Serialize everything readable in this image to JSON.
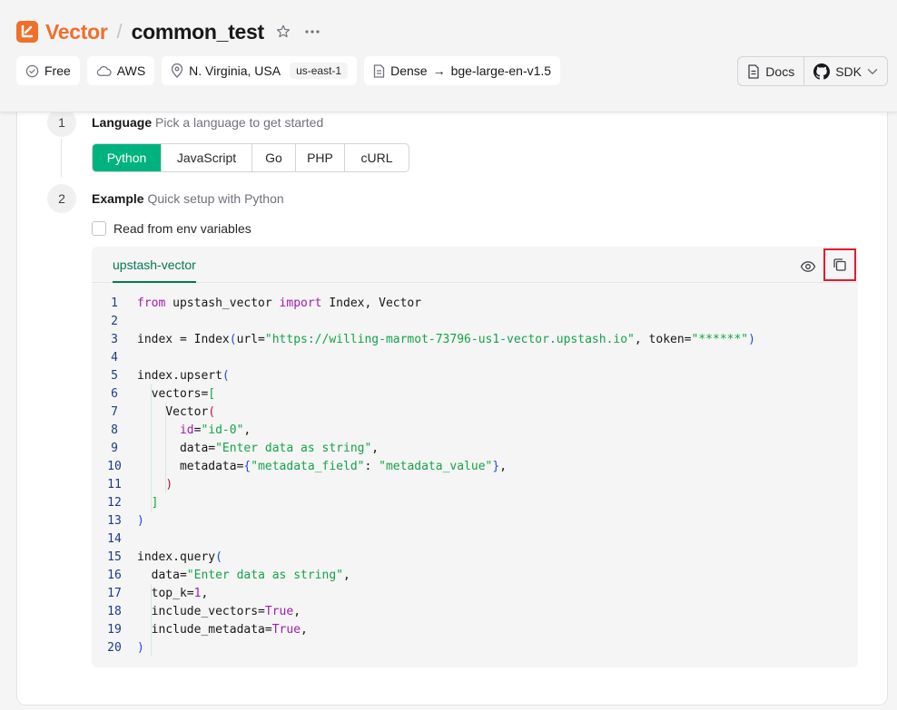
{
  "header": {
    "brand": "Vector",
    "separator": "/",
    "project_name": "common_test",
    "chips": {
      "plan": "Free",
      "cloud": "AWS",
      "region": "N. Virginia, USA",
      "region_code": "us-east-1",
      "index_type": "Dense",
      "arrow": "→",
      "model": "bge-large-en-v1.5"
    },
    "docs_label": "Docs",
    "sdk_label": "SDK"
  },
  "steps": [
    {
      "number": "1",
      "title": "Language",
      "subtitle": "Pick a language to get started"
    },
    {
      "number": "2",
      "title": "Example",
      "subtitle": "Quick setup with Python"
    }
  ],
  "languages": [
    "Python",
    "JavaScript",
    "Go",
    "PHP",
    "cURL"
  ],
  "selected_language": "Python",
  "env_checkbox_label": "Read from env variables",
  "code_tab": "upstash-vector",
  "code_lines": [
    {
      "n": "1"
    },
    {
      "n": "2"
    },
    {
      "n": "3"
    },
    {
      "n": "4"
    },
    {
      "n": "5"
    },
    {
      "n": "6"
    },
    {
      "n": "7"
    },
    {
      "n": "8"
    },
    {
      "n": "9"
    },
    {
      "n": "10"
    },
    {
      "n": "11"
    },
    {
      "n": "12"
    },
    {
      "n": "13"
    },
    {
      "n": "14"
    },
    {
      "n": "15"
    },
    {
      "n": "16"
    },
    {
      "n": "17"
    },
    {
      "n": "18"
    },
    {
      "n": "19"
    },
    {
      "n": "20"
    }
  ],
  "code": {
    "l1_from": "from",
    "l1_a": " upstash_vector ",
    "l1_import": "import",
    "l1_b": " Index, Vector",
    "l3_a": "index = Index",
    "l3_p1": "(",
    "l3_b": "url=",
    "l3_url": "\"https://willing-marmot-73796-us1-vector.upstash.io\"",
    "l3_c": ", token=",
    "l3_tok": "\"******\"",
    "l3_p2": ")",
    "l5_a": "index.upsert",
    "l5_p": "(",
    "l6_a": "vectors=",
    "l6_p": "[",
    "l7_a": "Vector",
    "l7_p": "(",
    "l8_a": "id",
    "l8_b": "=",
    "l8_s": "\"id-0\"",
    "l8_c": ",",
    "l9_a": "data=",
    "l9_s": "\"Enter data as string\"",
    "l9_c": ",",
    "l10_a": "metadata=",
    "l10_p1": "{",
    "l10_k": "\"metadata_field\"",
    "l10_b": ": ",
    "l10_v": "\"metadata_value\"",
    "l10_p2": "}",
    "l10_c": ",",
    "l11_p": ")",
    "l12_p": "]",
    "l13_p": ")",
    "l15_a": "index.query",
    "l15_p": "(",
    "l16_a": "data=",
    "l16_s": "\"Enter data as string\"",
    "l16_c": ",",
    "l17_a": "top_k=",
    "l17_n": "1",
    "l17_c": ",",
    "l18_a": "include_vectors=",
    "l18_k": "True",
    "l18_c": ",",
    "l19_a": "include_metadata=",
    "l19_k": "True",
    "l19_c": ",",
    "l20_p": ")"
  },
  "colors": {
    "brand": "#f06f2a",
    "accent": "#00b37e",
    "highlight": "#e11d2b"
  }
}
